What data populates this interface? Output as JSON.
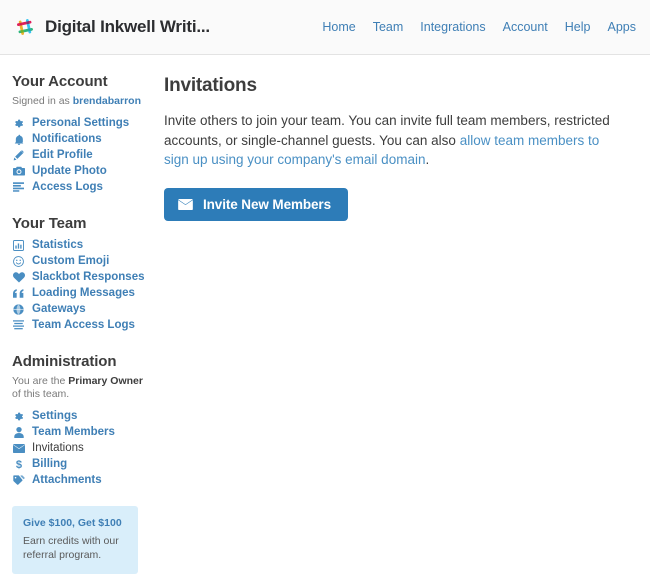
{
  "header": {
    "logo_icon": "slack-logo-icon",
    "brand_title": "Digital Inkwell Writi...",
    "nav": [
      {
        "label": "Home"
      },
      {
        "label": "Team"
      },
      {
        "label": "Integrations"
      },
      {
        "label": "Account"
      },
      {
        "label": "Help"
      },
      {
        "label": "Apps"
      }
    ]
  },
  "sidebar": {
    "account": {
      "heading": "Your Account",
      "signed_in_prefix": "Signed in as ",
      "username": "brendabarron",
      "items": [
        {
          "label": "Personal Settings",
          "icon": "gear-icon",
          "active": false
        },
        {
          "label": "Notifications",
          "icon": "bell-icon",
          "active": false
        },
        {
          "label": "Edit Profile",
          "icon": "pencil-icon",
          "active": false
        },
        {
          "label": "Update Photo",
          "icon": "camera-icon",
          "active": false
        },
        {
          "label": "Access Logs",
          "icon": "list-icon",
          "active": false
        }
      ]
    },
    "team": {
      "heading": "Your Team",
      "items": [
        {
          "label": "Statistics",
          "icon": "bar-chart-icon",
          "active": false
        },
        {
          "label": "Custom Emoji",
          "icon": "smiley-icon",
          "active": false
        },
        {
          "label": "Slackbot Responses",
          "icon": "heart-icon",
          "active": false
        },
        {
          "label": "Loading Messages",
          "icon": "quote-icon",
          "active": false
        },
        {
          "label": "Gateways",
          "icon": "globe-icon",
          "active": false
        },
        {
          "label": "Team Access Logs",
          "icon": "lines-icon",
          "active": false
        }
      ]
    },
    "administration": {
      "heading": "Administration",
      "role_prefix": "You are the ",
      "role": "Primary Owner",
      "role_suffix": " of this team.",
      "items": [
        {
          "label": "Settings",
          "icon": "gear-icon",
          "active": false
        },
        {
          "label": "Team Members",
          "icon": "person-icon",
          "active": false
        },
        {
          "label": "Invitations",
          "icon": "envelope-icon",
          "active": true
        },
        {
          "label": "Billing",
          "icon": "dollar-icon",
          "active": false
        },
        {
          "label": "Attachments",
          "icon": "tag-icon",
          "active": false
        }
      ]
    },
    "promo": {
      "title": "Give $100, Get $100",
      "text": "Earn credits with our referral program."
    }
  },
  "main": {
    "title": "Invitations",
    "description_part1": "Invite others to join your team. You can invite full team members, restricted accounts, or single-channel guests. You can also ",
    "description_link": "allow team members to sign up using your company's email domain",
    "description_part2": ".",
    "invite_button_label": "Invite New Members",
    "invite_button_icon": "envelope-icon"
  },
  "colors": {
    "link_blue": "#3f7fb5",
    "button_blue": "#2d7cb8",
    "promo_bg": "#d9eefa",
    "header_bg": "#fafafa",
    "text_dark": "#3d3d3d"
  }
}
